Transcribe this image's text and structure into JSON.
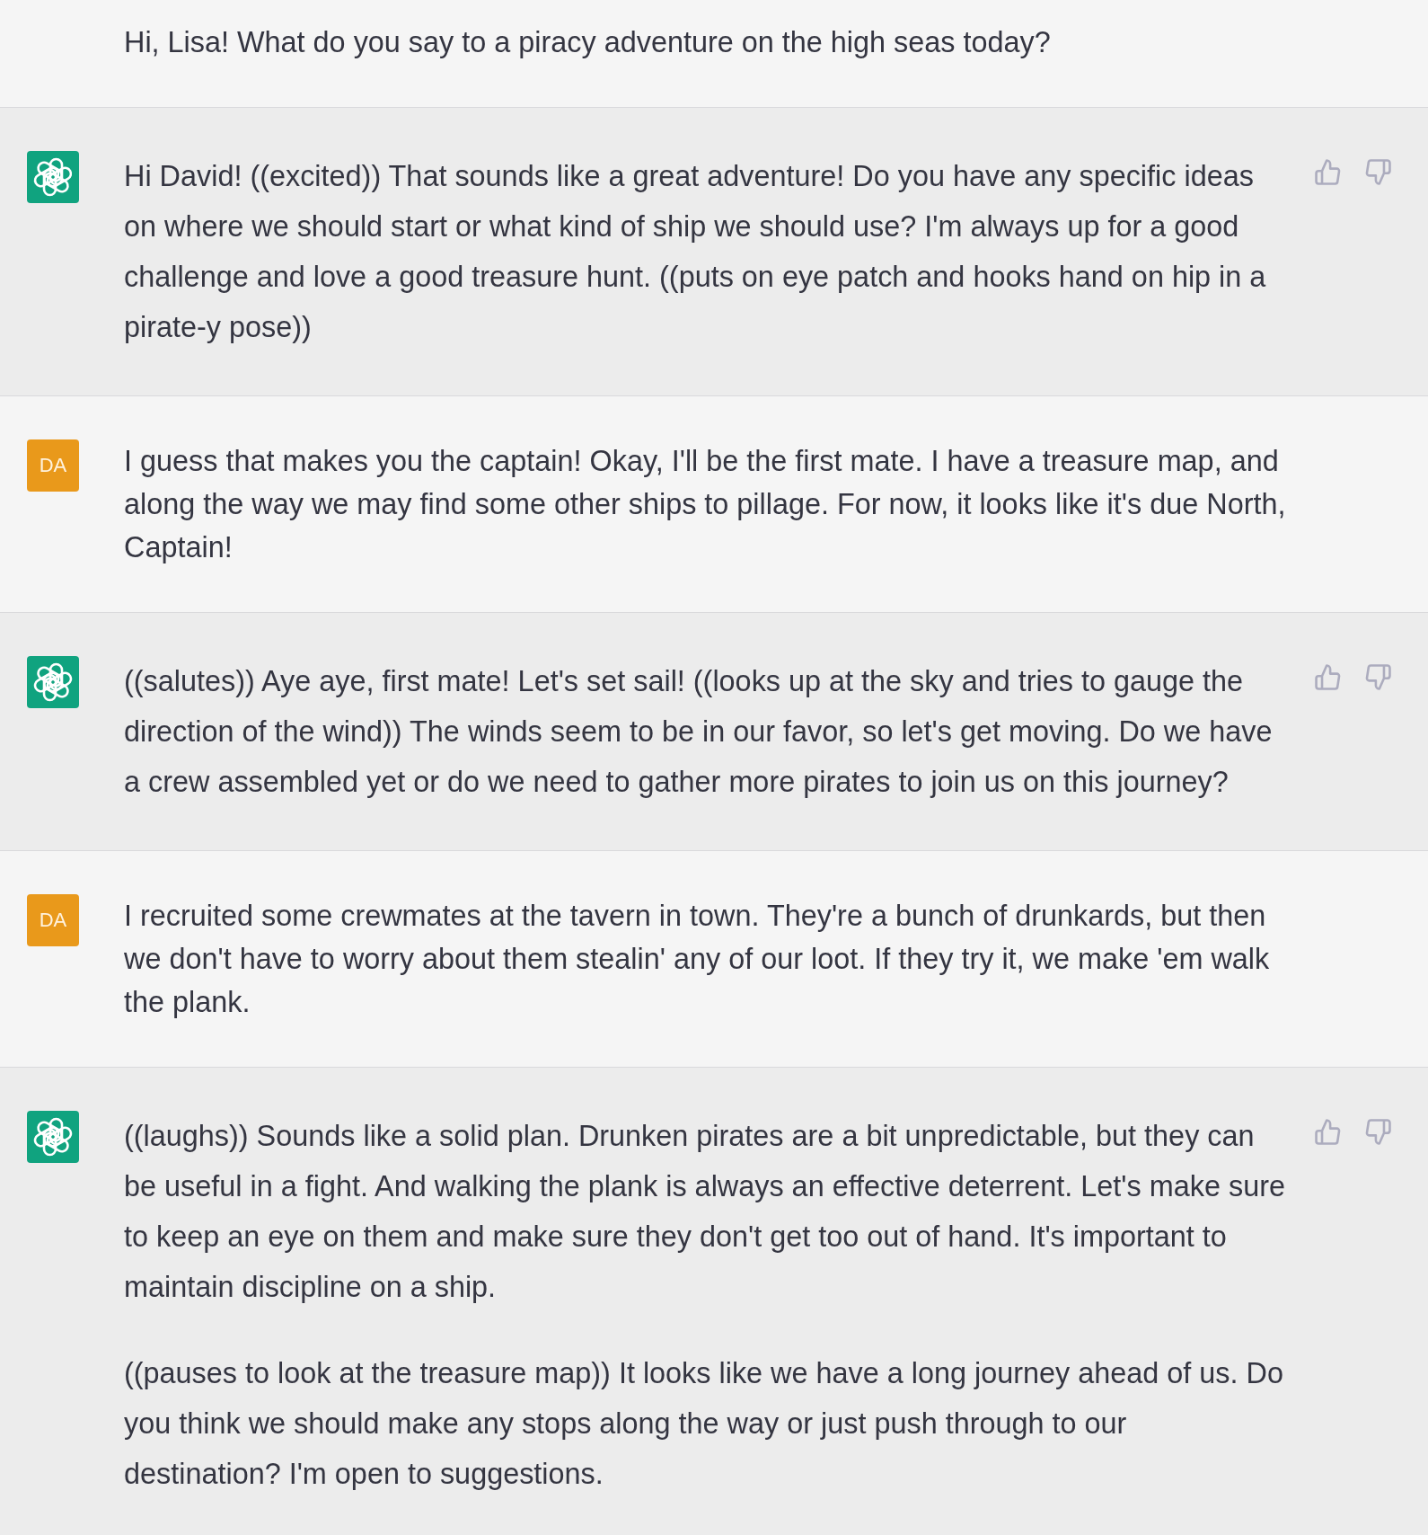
{
  "conversation": {
    "messages": [
      {
        "kind": "user",
        "paragraphs": [
          "Hi, Lisa! What do you say to a piracy adventure on the high seas today?"
        ]
      },
      {
        "kind": "assistant",
        "paragraphs": [
          "Hi David! ((excited)) That sounds like a great adventure! Do you have any specific ideas on where we should start or what kind of ship we should use? I'm always up for a good challenge and love a good treasure hunt. ((puts on eye patch and hooks hand on hip in a pirate-y pose))"
        ]
      },
      {
        "kind": "user",
        "avatar": "DA",
        "paragraphs": [
          "I guess that makes you the captain! Okay, I'll be the first mate. I have a treasure map, and along the way we may find some other ships to pillage. For now, it looks like it's due North, Captain!"
        ]
      },
      {
        "kind": "assistant",
        "paragraphs": [
          "((salutes)) Aye aye, first mate! Let's set sail! ((looks up at the sky and tries to gauge the direction of the wind)) The winds seem to be in our favor, so let's get moving. Do we have a crew assembled yet or do we need to gather more pirates to join us on this journey?"
        ]
      },
      {
        "kind": "user",
        "avatar": "DA",
        "paragraphs": [
          "I recruited some crewmates at the tavern in town. They're a bunch of drunkards, but then we don't have to worry about them stealin' any of our loot. If they try it, we make 'em walk the plank."
        ]
      },
      {
        "kind": "assistant",
        "paragraphs": [
          "((laughs)) Sounds like a solid plan. Drunken pirates are a bit unpredictable, but they can be useful in a fight. And walking the plank is always an effective deterrent. Let's make sure to keep an eye on them and make sure they don't get too out of hand. It's important to maintain discipline on a ship.",
          "((pauses to look at the treasure map)) It looks like we have a long journey ahead of us. Do you think we should make any stops along the way or just push through to our destination? I'm open to suggestions."
        ]
      }
    ]
  }
}
